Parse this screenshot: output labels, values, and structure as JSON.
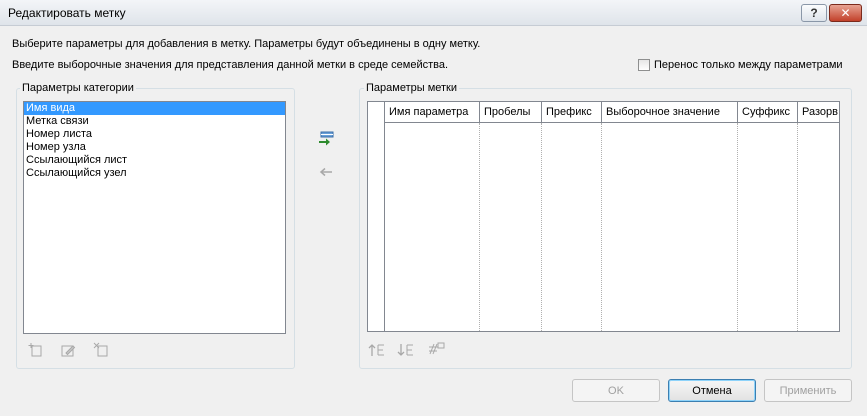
{
  "window": {
    "title": "Редактировать метку",
    "help_label": "?",
    "close_label": "✕"
  },
  "description": {
    "line1": "Выберите параметры для добавления в метку.  Параметры будут объединены в одну метку.",
    "line2": "Введите выборочные значения для представления данной метки в среде семейства."
  },
  "checkbox": {
    "label": "Перенос только между параметрами",
    "checked": false
  },
  "category_params": {
    "label": "Параметры категории",
    "items": [
      {
        "label": "Имя вида",
        "selected": true
      },
      {
        "label": "Метка связи",
        "selected": false
      },
      {
        "label": "Номер листа",
        "selected": false
      },
      {
        "label": "Номер узла",
        "selected": false
      },
      {
        "label": "Ссылающийся лист",
        "selected": false
      },
      {
        "label": "Ссылающийся узел",
        "selected": false
      }
    ],
    "tools": [
      "add-parameter-icon",
      "edit-parameter-icon",
      "remove-parameter-icon"
    ]
  },
  "transfer": {
    "add_icon": "add-to-label-icon",
    "remove_icon": "remove-from-label-icon"
  },
  "label_params": {
    "label": "Параметры метки",
    "columns": [
      "Имя параметра",
      "Пробелы",
      "Префикс",
      "Выборочное значение",
      "Суффикс",
      "Разорв"
    ],
    "rows": [],
    "tools": [
      "move-up-icon",
      "move-down-icon",
      "format-icon"
    ]
  },
  "buttons": {
    "ok": "OK",
    "cancel": "Отмена",
    "apply": "Применить"
  }
}
